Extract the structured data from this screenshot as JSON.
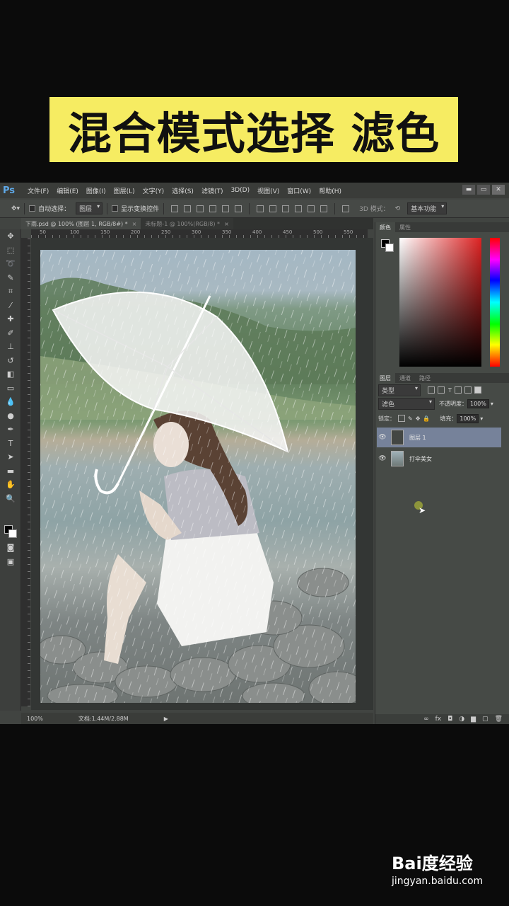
{
  "banner": {
    "text": "混合模式选择 滤色",
    "bg": "#f6ec62"
  },
  "app": {
    "logo": "Ps",
    "menu": [
      "文件(F)",
      "编辑(E)",
      "图像(I)",
      "图层(L)",
      "文字(Y)",
      "选择(S)",
      "滤镜(T)",
      "3D(D)",
      "视图(V)",
      "窗口(W)",
      "帮助(H)"
    ],
    "window_buttons": [
      "▬",
      "▭",
      "✕"
    ]
  },
  "options": {
    "auto_select_label": "自动选择：",
    "auto_select_value": "图层",
    "show_transform_label": "显示变换控件",
    "mode3d_label": "3D 模式：",
    "workspace": "基本功能"
  },
  "tabs": [
    {
      "label": "下雨.psd @ 100% (图层 1, RGB/8#) *",
      "close": "×"
    },
    {
      "label": "未标题-1 @ 100%(RGB/8) *",
      "close": "×"
    }
  ],
  "ruler_top": [
    "50",
    "100",
    "150",
    "200",
    "250",
    "300",
    "350",
    "400",
    "450",
    "500",
    "550"
  ],
  "status": {
    "zoom": "100%",
    "doc": "文档:1.44M/2.88M",
    "arrow": "▶"
  },
  "color_panel": {
    "tabs": [
      "颜色",
      "属性"
    ],
    "fg": "#000000",
    "bg": "#ffffff"
  },
  "layers_panel": {
    "tabs": [
      "图层",
      "通道",
      "路径"
    ],
    "filter_type": "类型",
    "blend_mode": "滤色",
    "opacity_label": "不透明度：",
    "opacity_value": "100%",
    "lock_label": "锁定：",
    "fill_label": "填充：",
    "fill_value": "100%",
    "layers": [
      {
        "name": "图层 1",
        "selected": true
      },
      {
        "name": "打伞美女",
        "selected": false
      }
    ],
    "footer_icons": [
      "link-icon",
      "fx-icon",
      "mask-icon",
      "adjustment-icon",
      "group-icon",
      "new-layer-icon",
      "trash-icon"
    ]
  },
  "watermark": {
    "logo": "Bai度经验",
    "url": "jingyan.baidu.com"
  }
}
